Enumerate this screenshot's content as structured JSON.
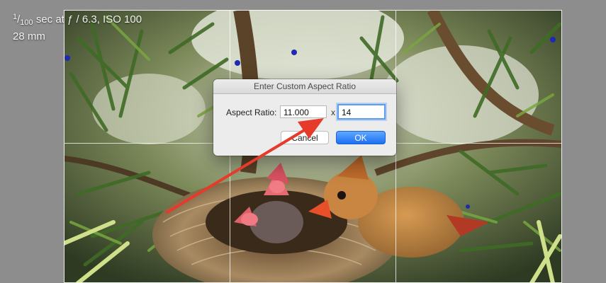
{
  "exif": {
    "shutter_num": "1",
    "shutter_den": "100",
    "shutter_suffix": " sec at ",
    "aperture": "ƒ / 6.3, ISO 100",
    "focal_length": "28 mm"
  },
  "dialog": {
    "title": "Enter Custom Aspect Ratio",
    "label": "Aspect Ratio:",
    "width_value": "11.000",
    "separator": "x",
    "height_value": "14",
    "cancel_label": "Cancel",
    "ok_label": "OK"
  },
  "colors": {
    "background": "#8d8d8d",
    "ok_button": "#2a7cf6",
    "focus_ring": "#5a9cf0",
    "annotation_arrow": "#e63a2a"
  },
  "icons": {
    "annotation": "red-arrow-icon"
  }
}
